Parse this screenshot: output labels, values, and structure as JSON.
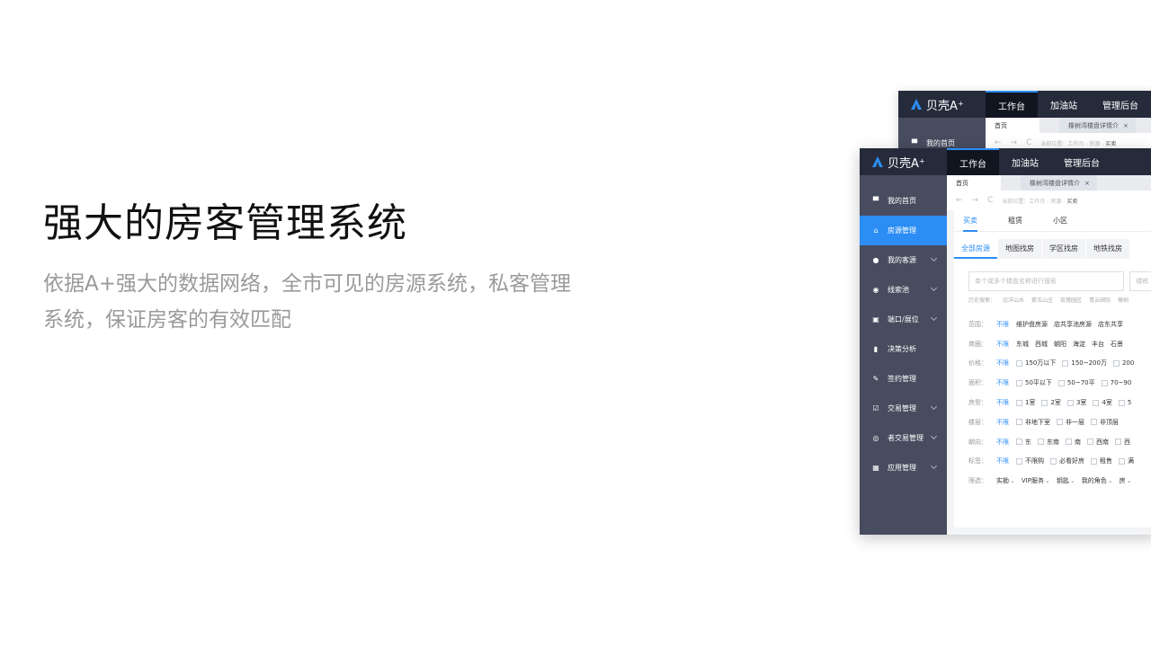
{
  "hero": {
    "title": "强大的房客管理系统",
    "description": "依据A+强大的数据网络，全市可见的房源系统，私客管理系统，保证房客的有效匹配"
  },
  "app": {
    "logo_text": "贝壳A⁺",
    "top_nav": [
      "工作台",
      "加油站",
      "管理后台"
    ],
    "tabs": {
      "home": "首页",
      "active": "橡树湾楼盘详情介",
      "close": "×"
    },
    "breadcrumb": {
      "prefix": "当前位置：工作台 - 房源 - ",
      "current": "买卖"
    },
    "sidebar": [
      {
        "label": "我的首页",
        "icon": "monitor-icon",
        "glyph": "▀"
      },
      {
        "label": "房源管理",
        "icon": "house-icon",
        "glyph": "⌂"
      },
      {
        "label": "我的客源",
        "icon": "user-icon",
        "glyph": "●"
      },
      {
        "label": "线索池",
        "icon": "compass-icon",
        "glyph": "◉"
      },
      {
        "label": "端口/展位",
        "icon": "port-icon",
        "glyph": "▣"
      },
      {
        "label": "决策分析",
        "icon": "chart-icon",
        "glyph": "▮"
      },
      {
        "label": "签约管理",
        "icon": "pen-icon",
        "glyph": "✎"
      },
      {
        "label": "交易管理",
        "icon": "check-box-icon",
        "glyph": "☑"
      },
      {
        "label": "者交易管理",
        "icon": "target-icon",
        "glyph": "◎"
      },
      {
        "label": "应用管理",
        "icon": "grid-icon",
        "glyph": "▦"
      }
    ],
    "subtabs": [
      "买卖",
      "租赁",
      "小区"
    ],
    "modes": [
      "全部房源",
      "地图找房",
      "学区找房",
      "地铁找房"
    ],
    "search_placeholder": "单个或多个楼盘名称进行搜索",
    "search2_placeholder": "楼栋",
    "history": [
      "历史搜索：",
      "远洋山水",
      "紫玉山庄",
      "玫瑰园区",
      "青云国际",
      "橡树"
    ],
    "filters": [
      {
        "label": "范围：",
        "all": "不限",
        "options": [
          "维护盘房源",
          "店共享池房源",
          "店东共享"
        ],
        "checkbox": false
      },
      {
        "label": "商圈：",
        "all": "不限",
        "options": [
          "东城",
          "西城",
          "朝阳",
          "海淀",
          "丰台",
          "石景"
        ],
        "checkbox": false
      },
      {
        "label": "价格：",
        "all": "不限",
        "options": [
          "150万以下",
          "150~200万",
          "200"
        ],
        "checkbox": true
      },
      {
        "label": "面积：",
        "all": "不限",
        "options": [
          "50平以下",
          "50~70平",
          "70~90"
        ],
        "checkbox": true
      },
      {
        "label": "房型：",
        "all": "不限",
        "options": [
          "1室",
          "2室",
          "3室",
          "4室",
          "5"
        ],
        "checkbox": true
      },
      {
        "label": "楼层：",
        "all": "不限",
        "options": [
          "非地下室",
          "非一层",
          "非顶层"
        ],
        "checkbox": true
      },
      {
        "label": "朝向：",
        "all": "不限",
        "options": [
          "东",
          "东南",
          "南",
          "西南",
          "西"
        ],
        "checkbox": true
      },
      {
        "label": "标签：",
        "all": "不限",
        "options": [
          "不限购",
          "必看好房",
          "租售",
          "满"
        ],
        "checkbox": true
      }
    ],
    "screen": {
      "label": "筛选：",
      "options": [
        "实勘",
        "VIP服务",
        "钥匙",
        "我的角色",
        "房"
      ]
    }
  }
}
